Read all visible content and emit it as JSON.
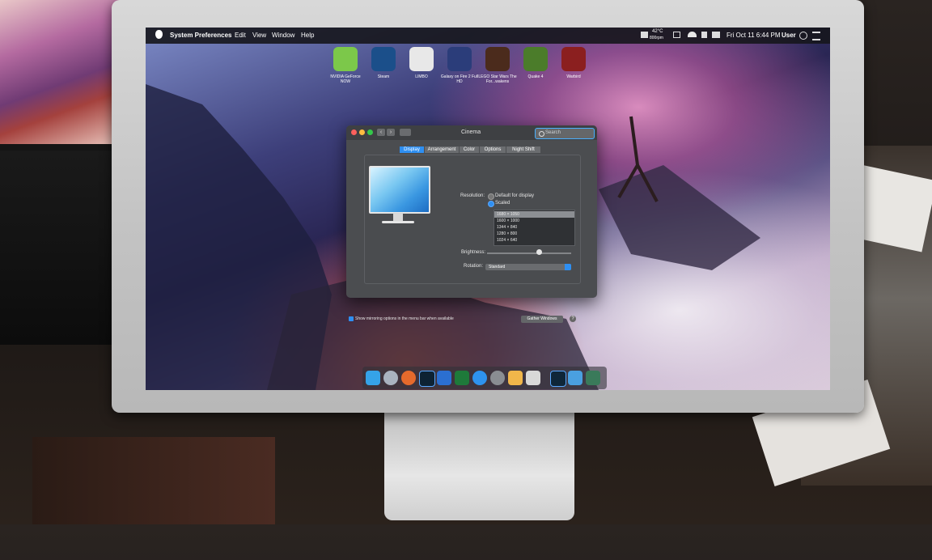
{
  "menubar": {
    "app": "System Preferences",
    "items": [
      "Edit",
      "View",
      "Window",
      "Help"
    ],
    "weather_temp": "42°C",
    "weather_rpm": "800rpm",
    "datetime": "Fri Oct 11  6:44 PM",
    "user": "User"
  },
  "desktop_icons": [
    {
      "label": "NVIDIA GeForce NOW",
      "icon": "nvidia-icon",
      "color": "#7cc84a"
    },
    {
      "label": "Steam",
      "icon": "steam-icon",
      "color": "#1b4f8a"
    },
    {
      "label": "LIMBO",
      "icon": "limbo-icon",
      "color": "#e8e8e8"
    },
    {
      "label": "Galaxy on Fire 2 Full HD",
      "icon": "galaxy-icon",
      "color": "#2b3d7a"
    },
    {
      "label": "LEGO Star Wars The For...wakens",
      "icon": "lego-icon",
      "color": "#4b2b1c"
    },
    {
      "label": "Quake 4",
      "icon": "quake-icon",
      "color": "#4b7c2a"
    },
    {
      "label": "Warbird",
      "icon": "warbird-icon",
      "color": "#8b1f1f"
    }
  ],
  "window": {
    "title": "Cinema",
    "search_placeholder": "Search",
    "tabs": [
      "Display",
      "Arrangement",
      "Color",
      "Options",
      "Night Shift"
    ],
    "active_tab": "Display",
    "resolution_label": "Resolution:",
    "resolution_options": [
      "Default for display",
      "Scaled"
    ],
    "resolution_selected": "Scaled",
    "resolutions": [
      "1680 × 1050",
      "1600 × 1000",
      "1344 × 840",
      "1280 × 800",
      "1024 × 640"
    ],
    "resolution_selected_item": "1680 × 1050",
    "brightness_label": "Brightness:",
    "brightness_value": 0.62,
    "rotation_label": "Rotation:",
    "rotation_value": "Standard",
    "mirror_checkbox": "Show mirroring options in the menu bar when available",
    "gather_button": "Gather Windows",
    "help_button": "?"
  },
  "dock": {
    "items": [
      {
        "name": "finder-icon",
        "color": "#35a3e8"
      },
      {
        "name": "launchpad-icon",
        "color": "#aab3bf"
      },
      {
        "name": "firefox-icon",
        "color": "#e66a2c"
      },
      {
        "name": "lightroom-icon",
        "color": "#0d2233"
      },
      {
        "name": "word-icon",
        "color": "#2b6fd1"
      },
      {
        "name": "excel-icon",
        "color": "#1e7a3a"
      },
      {
        "name": "appstore-icon",
        "color": "#2e93ef"
      },
      {
        "name": "system-preferences-icon",
        "color": "#8a8d92"
      },
      {
        "name": "photos-icon",
        "color": "#f1b64a"
      },
      {
        "name": "roblox-icon",
        "color": "#d8d8d8"
      },
      {
        "name": "lightroom-classic-icon",
        "color": "#0f2638"
      },
      {
        "name": "folder-icon",
        "color": "#4aa0e0"
      },
      {
        "name": "trash-icon",
        "color": "#3a7a5a"
      }
    ]
  }
}
